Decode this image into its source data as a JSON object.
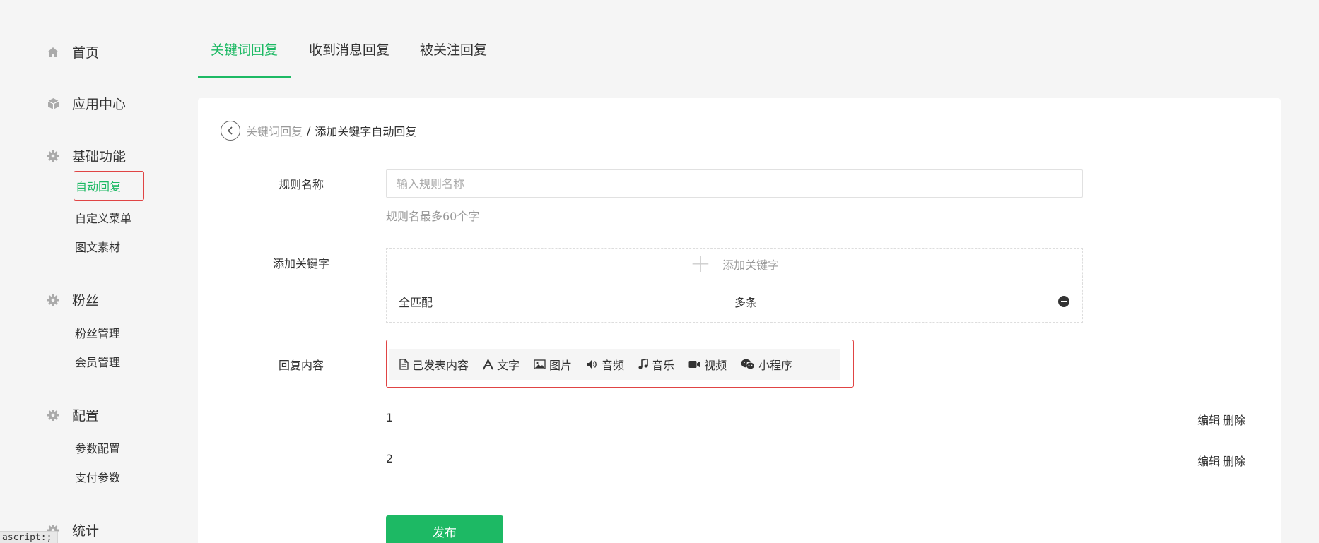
{
  "sidebar": {
    "groups": [
      {
        "label": "首页",
        "icon": "home-icon"
      },
      {
        "label": "应用中心",
        "icon": "cube-icon"
      },
      {
        "label": "基础功能",
        "icon": "gear-icon"
      },
      {
        "label": "粉丝",
        "icon": "gear-icon"
      },
      {
        "label": "配置",
        "icon": "gear-icon"
      },
      {
        "label": "统计",
        "icon": "gear-icon"
      }
    ],
    "items": {
      "auto_reply": "自动回复",
      "custom_menu": "自定义菜单",
      "graphic_material": "图文素材",
      "fans_management": "粉丝管理",
      "member_management": "会员管理",
      "param_config": "参数配置",
      "payment_params": "支付参数"
    }
  },
  "tabs": [
    {
      "label": "关键词回复",
      "active": true
    },
    {
      "label": "收到消息回复",
      "active": false
    },
    {
      "label": "被关注回复",
      "active": false
    }
  ],
  "breadcrumb": {
    "parent": "关键词回复",
    "separator": "/",
    "current": "添加关键字自动回复"
  },
  "form": {
    "rule_name_label": "规则名称",
    "rule_name_placeholder": "输入规则名称",
    "rule_name_value": "",
    "rule_name_hint": "规则名最多60个字",
    "keyword_label": "添加关键字",
    "keyword_add_text": "添加关键字",
    "keyword_rows": [
      {
        "match": "全匹配",
        "mode": "多条"
      }
    ],
    "reply_label": "回复内容",
    "reply_types": [
      {
        "label": "己发表内容",
        "icon": "document-icon"
      },
      {
        "label": "文字",
        "icon": "text-icon"
      },
      {
        "label": "图片",
        "icon": "image-icon"
      },
      {
        "label": "音频",
        "icon": "volume-icon"
      },
      {
        "label": "音乐",
        "icon": "music-icon"
      },
      {
        "label": "视频",
        "icon": "video-icon"
      },
      {
        "label": "小程序",
        "icon": "wechat-icon"
      }
    ],
    "reply_list": [
      {
        "index": "1",
        "edit": "编辑",
        "delete": "删除"
      },
      {
        "index": "2",
        "edit": "编辑",
        "delete": "删除"
      }
    ],
    "publish_label": "发布"
  },
  "status_tip": "ascript:;",
  "colors": {
    "accent": "#1db964",
    "highlight_border": "#e04444"
  }
}
